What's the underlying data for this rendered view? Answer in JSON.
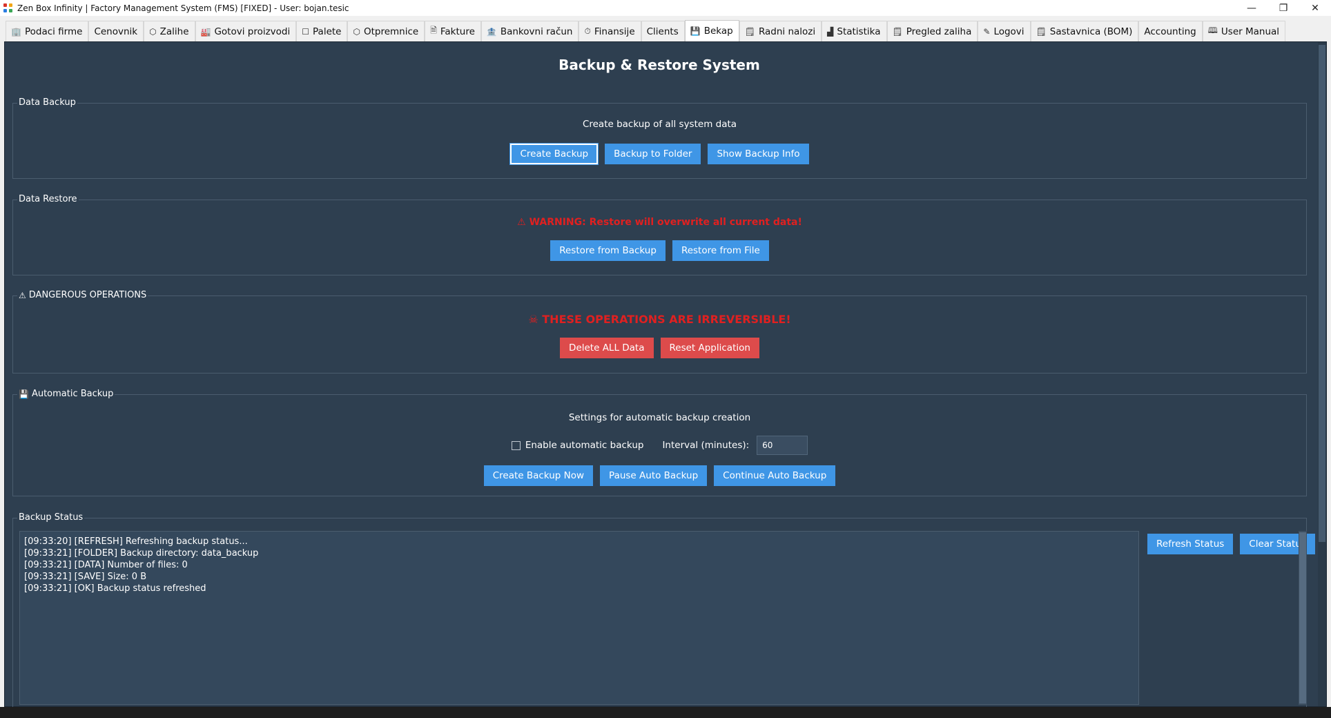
{
  "window": {
    "title": "Zen Box Infinity | Factory Management System (FMS) [FIXED] - User: bojan.tesic",
    "minimize_glyph": "—",
    "maximize_glyph": "❐",
    "close_glyph": "✕"
  },
  "tabs": [
    {
      "label": "Podaci firme",
      "icon": "🏢",
      "icon_name": "building-icon"
    },
    {
      "label": "Cenovnik",
      "icon": "",
      "icon_name": ""
    },
    {
      "label": "Zalihe",
      "icon": "⬡",
      "icon_name": "box-icon"
    },
    {
      "label": "Gotovi proizvodi",
      "icon": "🏭",
      "icon_name": "factory-icon"
    },
    {
      "label": "Palete",
      "icon": "☐",
      "icon_name": "pallet-icon"
    },
    {
      "label": "Otpremnice",
      "icon": "⬡",
      "icon_name": "package-icon"
    },
    {
      "label": "Fakture",
      "icon": "🗎",
      "icon_name": "invoice-icon"
    },
    {
      "label": "Bankovni račun",
      "icon": "🏦",
      "icon_name": "bank-icon"
    },
    {
      "label": "Finansije",
      "icon": "⏱",
      "icon_name": "finance-icon"
    },
    {
      "label": "Clients",
      "icon": "",
      "icon_name": ""
    },
    {
      "label": "Bekap",
      "icon": "💾",
      "icon_name": "save-icon",
      "active": true
    },
    {
      "label": "Radni nalozi",
      "icon": "🗒",
      "icon_name": "work-order-icon"
    },
    {
      "label": "Statistika",
      "icon": "▟",
      "icon_name": "chart-icon"
    },
    {
      "label": "Pregled zaliha",
      "icon": "🗒",
      "icon_name": "clipboard-icon"
    },
    {
      "label": "Logovi",
      "icon": "✎",
      "icon_name": "log-icon"
    },
    {
      "label": "Sastavnica (BOM)",
      "icon": "🗒",
      "icon_name": "bom-icon"
    },
    {
      "label": "Accounting",
      "icon": "",
      "icon_name": ""
    },
    {
      "label": "User Manual",
      "icon": "🕮",
      "icon_name": "book-icon"
    }
  ],
  "page": {
    "title": "Backup & Restore System"
  },
  "data_backup": {
    "legend": "Data Backup",
    "description": "Create backup of all system data",
    "buttons": {
      "create": "Create Backup",
      "to_folder": "Backup to Folder",
      "info": "Show Backup Info"
    }
  },
  "data_restore": {
    "legend": "Data Restore",
    "warning_icon": "⚠",
    "warning": "WARNING: Restore will overwrite all current data!",
    "buttons": {
      "from_backup": "Restore from Backup",
      "from_file": "Restore from File"
    }
  },
  "dangerous": {
    "legend_icon": "⚠",
    "legend": "DANGEROUS OPERATIONS",
    "warning_icon": "☠",
    "warning": "THESE OPERATIONS ARE IRREVERSIBLE!",
    "buttons": {
      "delete_all": "Delete ALL Data",
      "reset": "Reset Application"
    }
  },
  "auto_backup": {
    "legend_icon": "💾",
    "legend": "Automatic Backup",
    "description": "Settings for automatic backup creation",
    "enable_label": "Enable automatic backup",
    "enabled": false,
    "interval_label": "Interval (minutes):",
    "interval_value": "60",
    "buttons": {
      "now": "Create Backup Now",
      "pause": "Pause Auto Backup",
      "continue": "Continue Auto Backup"
    }
  },
  "backup_status": {
    "legend": "Backup Status",
    "log": [
      "[09:33:20] [REFRESH] Refreshing backup status...",
      "[09:33:21] [FOLDER] Backup directory: data_backup",
      "[09:33:21] [DATA] Number of files: 0",
      "[09:33:21] [SAVE] Size: 0 B",
      "[09:33:21] [OK] Backup status refreshed"
    ],
    "buttons": {
      "refresh": "Refresh Status",
      "clear": "Clear Status"
    }
  },
  "colors": {
    "panel_bg": "#2e3f50",
    "button_blue": "#3f96e6",
    "button_red": "#dd4b4b",
    "warning_red": "#e02020"
  }
}
